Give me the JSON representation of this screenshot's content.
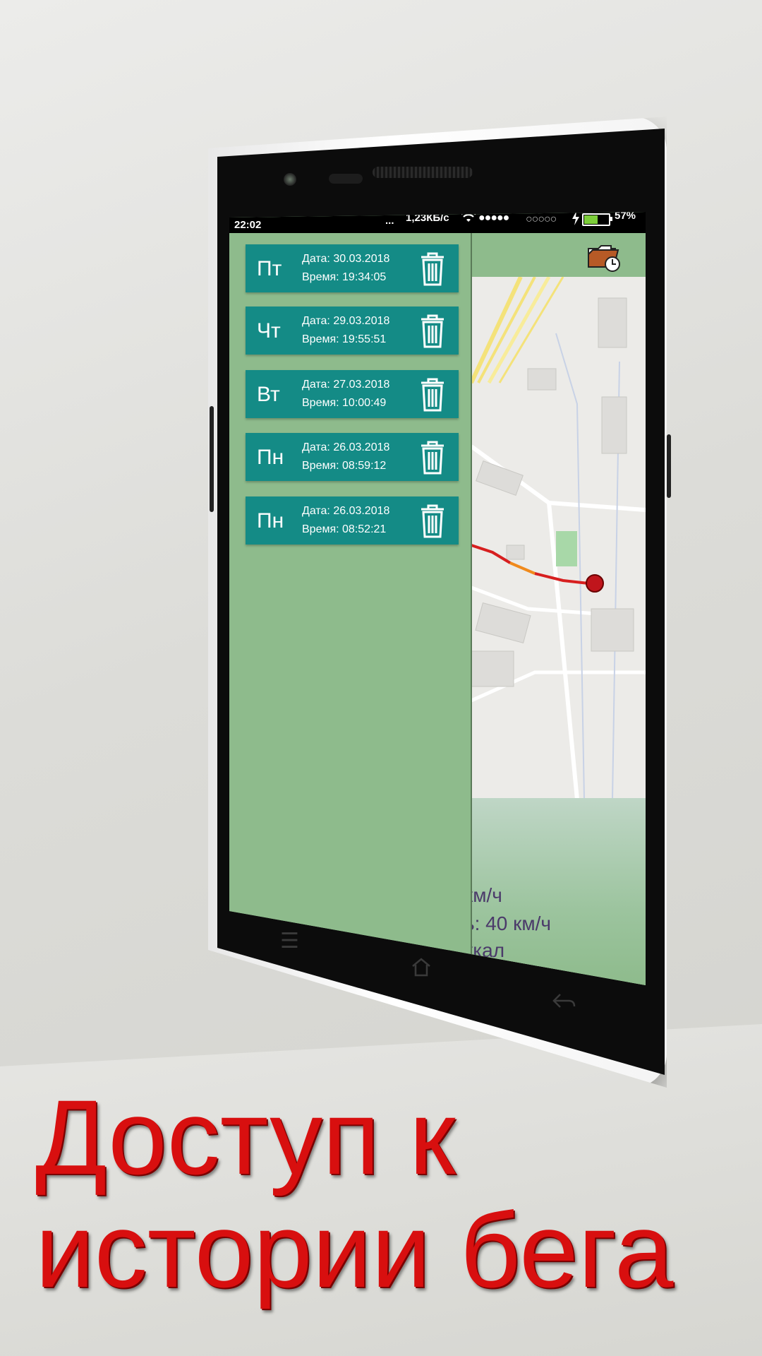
{
  "status_bar": {
    "time": "22:02",
    "dots": "...",
    "network_speed": "1,23КБ/с",
    "wifi_icon": "wifi-icon",
    "signal_primary": "●●●●●",
    "signal_secondary": "○○○○○",
    "battery_percent": "57%",
    "battery_level": 0.57
  },
  "history": {
    "items": [
      {
        "day": "Пт",
        "date": "Дата: 30.03.2018",
        "time": "Время: 19:34:05"
      },
      {
        "day": "Чт",
        "date": "Дата: 29.03.2018",
        "time": "Время: 19:55:51"
      },
      {
        "day": "Вт",
        "date": "Дата: 27.03.2018",
        "time": "Время: 10:00:49"
      },
      {
        "day": "Пн",
        "date": "Дата: 26.03.2018",
        "time": "Время: 08:59:12"
      },
      {
        "day": "Пн",
        "date": "Дата: 26.03.2018",
        "time": "Время: 08:52:21"
      }
    ]
  },
  "map_panel": {
    "speed_text": "км/ч",
    "max_speed_text": "ь: 40 км/ч",
    "calories_text": "ккал"
  },
  "caption": {
    "line1": "Доступ к",
    "line2": "истории бега"
  },
  "colors": {
    "accent_card": "#148b86",
    "panel_green": "#8ebb8c",
    "caption_red": "#d80f0f",
    "track_red": "#d71f1f"
  }
}
